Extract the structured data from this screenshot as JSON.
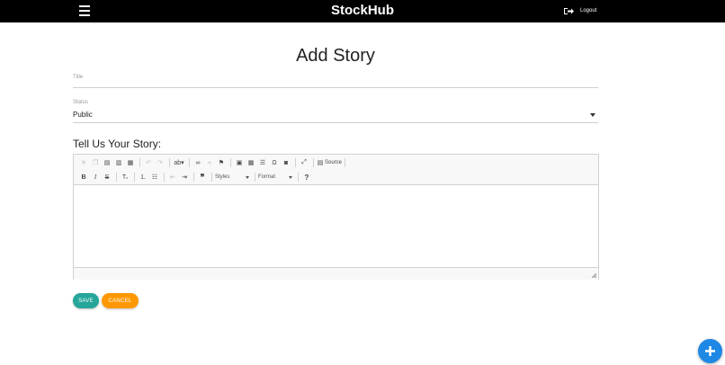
{
  "navbar": {
    "brand": "StockHub",
    "logout_label": "Logout"
  },
  "page": {
    "title": "Add Story"
  },
  "form": {
    "title_label": "Title",
    "status_label": "Status",
    "status_value": "Public",
    "story_heading": "Tell Us Your Story:"
  },
  "editor": {
    "toolbar_row1_icons": [
      "cut-icon",
      "copy-icon",
      "paste-icon",
      "paste-text-icon",
      "paste-word-icon",
      "undo-icon",
      "redo-icon",
      "spellcheck-icon",
      "link-icon",
      "unlink-icon",
      "anchor-icon",
      "image-icon",
      "table-icon",
      "horizontal-line-icon",
      "special-char-icon",
      "iframe-icon",
      "maximize-icon",
      "source-icon"
    ],
    "source_label": "Source",
    "styles_label": "Styles",
    "format_label": "Format",
    "help_label": "?"
  },
  "actions": {
    "save_label": "SAVE",
    "cancel_label": "CANCEL"
  },
  "colors": {
    "navbar": "#000000",
    "save": "#26a69a",
    "cancel": "#ff9800",
    "fab": "#1e88e5"
  }
}
